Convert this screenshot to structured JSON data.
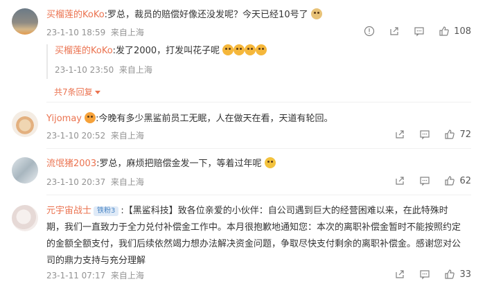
{
  "comments": [
    {
      "name": "买榴莲的KoKo",
      "text": ":罗总，裁员的赔偿好像还没发呢？今天已经10号了",
      "emoji": "doge-emoji",
      "date": "23-1-10 18:59",
      "location": "来自上海",
      "likes": "108",
      "reply": {
        "name": "买榴莲的KoKo",
        "text": ":发了2000，打发叫花子呢",
        "date": "23-1-10 23:50",
        "location": "来自上海"
      },
      "more_replies": "共7条回复"
    },
    {
      "name": "Yijomay",
      "text": ":今晚有多少黑鲨前员工无眠，人在做天在看，天道有轮回。",
      "date": "23-1-10 20:52",
      "location": "来自上海",
      "likes": "72"
    },
    {
      "name": "流氓猪2003",
      "text": ":罗总，麻烦把赔偿金发一下，等着过年呢",
      "date": "23-1-10 20:37",
      "location": "来自上海",
      "likes": "62"
    },
    {
      "name": "元宇宙战士",
      "badge": "铁粉3",
      "text_lines": [
        ":【黑鲨科技】致各位亲爱的小伙伴：自公司遇到巨大的经营困难以来，在此特殊时",
        "期，我们一直致力于全力兑付补偿金工作中。本月很抱歉地通知您：本次的离职补偿金暂时不能按照约定",
        "的金额全额支付，我们后续依然竭力想办法解决资金问题，争取尽快支付剩余的离职补偿金。感谢您对公",
        "司的鼎力支持与充分理解"
      ],
      "date": "23-1-11 07:17",
      "location": "来自上海",
      "likes": "33"
    }
  ],
  "colors": {
    "name": "#eb7350",
    "meta": "#939393",
    "text": "#333333"
  },
  "icons": [
    "info-icon",
    "share-icon",
    "comment-icon",
    "like-icon",
    "fire-icon",
    "angry-emoji",
    "cry-emoji"
  ]
}
